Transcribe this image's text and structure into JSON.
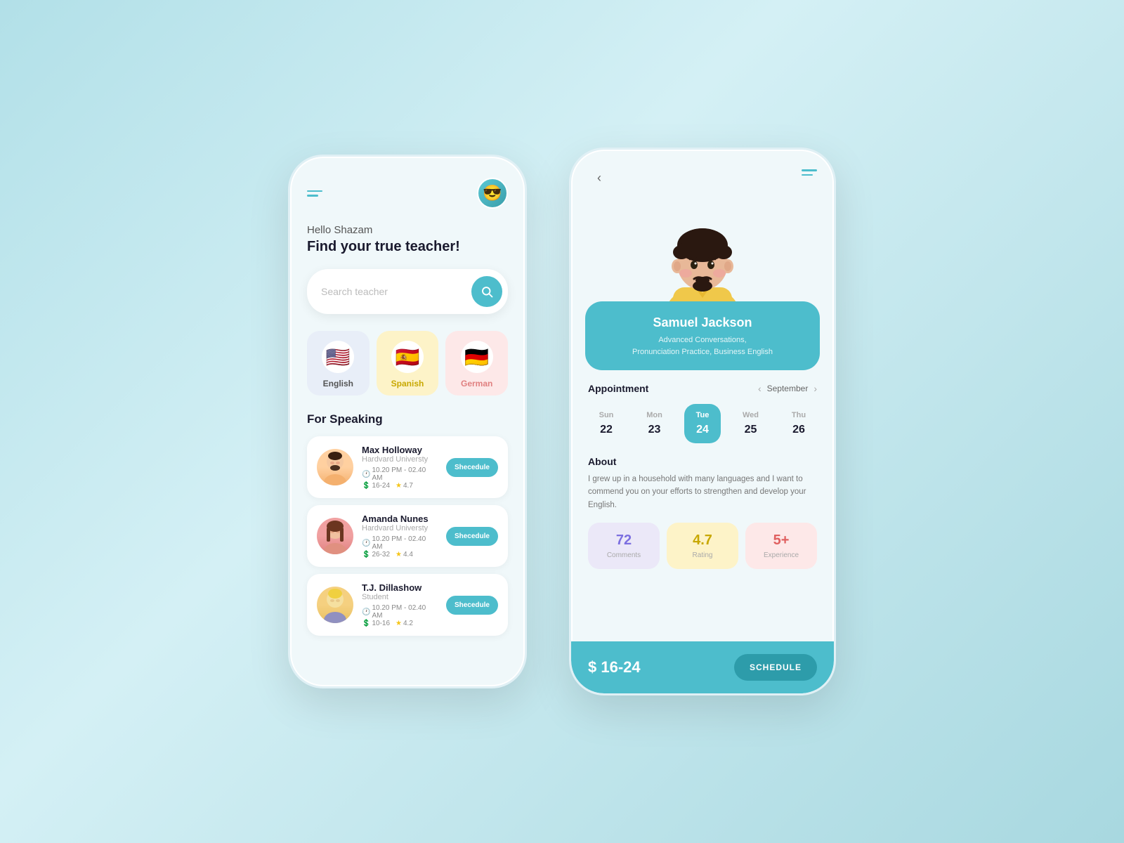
{
  "background": "#b2dfe8",
  "left_phone": {
    "greeting": "Hello Shazam",
    "tagline": "Find your true teacher!",
    "search_placeholder": "Search teacher",
    "languages": [
      {
        "name": "English",
        "flag": "🇺🇸",
        "id": "english"
      },
      {
        "name": "Spanish",
        "flag": "🇪🇸",
        "id": "spanish"
      },
      {
        "name": "German",
        "flag": "🇩🇪",
        "id": "german"
      }
    ],
    "section_title": "For Speaking",
    "teachers": [
      {
        "name": "Max Holloway",
        "university": "Hardvard Universty",
        "time": "10.20 PM - 02.40 AM",
        "price": "16-24",
        "rating": "4.7",
        "btn": "Shecedule"
      },
      {
        "name": "Amanda Nunes",
        "university": "Hardvard Universty",
        "time": "10.20 PM - 02.40 AM",
        "price": "26-32",
        "rating": "4.4",
        "btn": "Shecedule"
      },
      {
        "name": "T.J. Dillashow",
        "university": "Student",
        "time": "10.20 PM - 02.40 AM",
        "price": "10-16",
        "rating": "4.2",
        "btn": "Shecedule"
      }
    ]
  },
  "right_phone": {
    "teacher_name": "Samuel Jackson",
    "teacher_skills": "Advanced Conversations,\nPronunciation Practice, Business English",
    "appointment_label": "Appointment",
    "month": "September",
    "calendar": [
      {
        "day": "Sun",
        "num": "22",
        "active": false
      },
      {
        "day": "Mon",
        "num": "23",
        "active": false
      },
      {
        "day": "Tue",
        "num": "24",
        "active": true
      },
      {
        "day": "Wed",
        "num": "25",
        "active": false
      },
      {
        "day": "Thu",
        "num": "26",
        "active": false
      }
    ],
    "about_title": "About",
    "about_text": "I grew up in a household with many languages and I want to commend you on your efforts to strengthen and develop your English.",
    "stats": [
      {
        "value": "72",
        "label": "Comments",
        "theme": "purple"
      },
      {
        "value": "4.7",
        "label": "Rating",
        "theme": "yellow"
      },
      {
        "value": "5+",
        "label": "Experience",
        "theme": "pink"
      }
    ],
    "price": "$ 16-24",
    "schedule_btn": "SCHEDULE"
  }
}
